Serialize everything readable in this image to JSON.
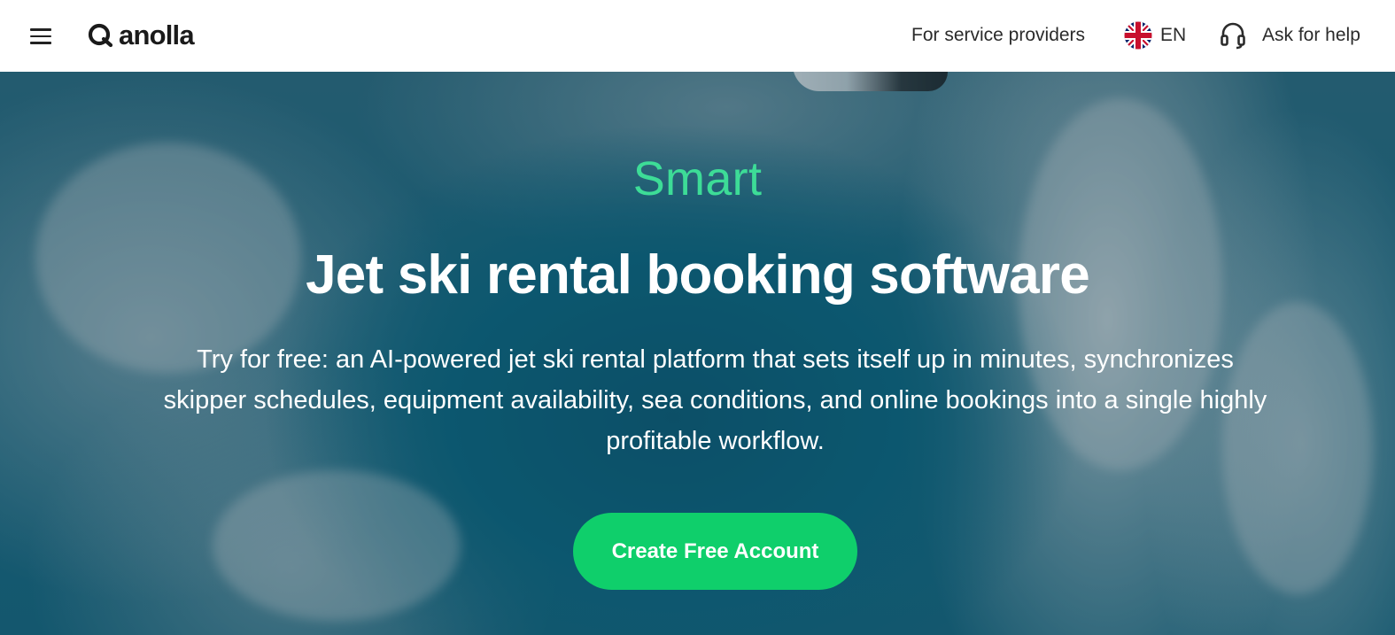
{
  "header": {
    "menu_icon": "hamburger-icon",
    "logo_text": "anolla",
    "providers_label": "For service providers",
    "language": {
      "flag_icon": "uk-flag-icon",
      "label": "EN"
    },
    "help": {
      "icon": "headset-icon",
      "label": "Ask for help"
    }
  },
  "hero": {
    "eyebrow": "Smart",
    "headline": "Jet ski rental booking software",
    "subtext": "Try for free: an AI-powered jet ski rental platform that sets itself up in minutes, synchronizes skipper schedules, equipment availability, sea conditions, and online bookings into a single highly profitable workflow.",
    "cta_label": "Create Free Account"
  },
  "colors": {
    "accent_green": "#0fcf6b",
    "eyebrow_green": "#3ddc97",
    "header_bg": "#ffffff",
    "ocean": "#0f6a85"
  }
}
